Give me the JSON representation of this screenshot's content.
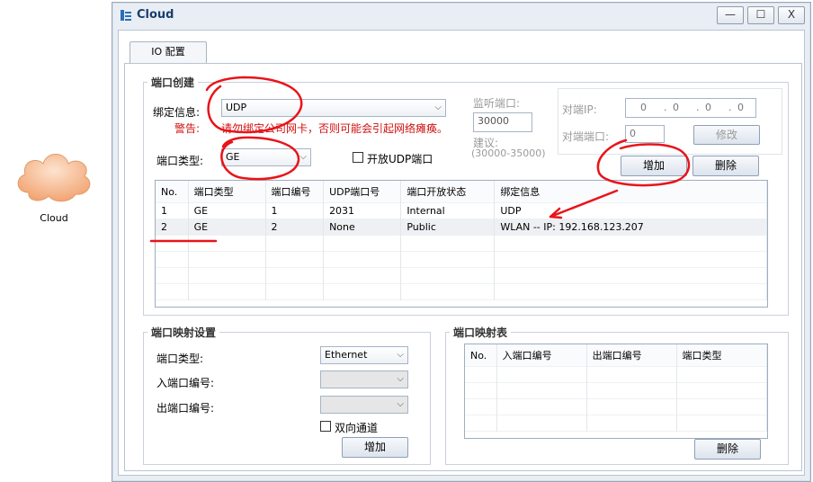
{
  "desktop": {
    "cloud_label": "Cloud"
  },
  "window": {
    "title": "Cloud",
    "controls": {
      "minimize": "—",
      "maximize": "☐",
      "close": "X"
    }
  },
  "tab": {
    "label": "IO 配置"
  },
  "port_create": {
    "title": "端口创建",
    "bind_label": "绑定信息:",
    "bind_value": "UDP",
    "warning_label": "警告:",
    "warning_text": "请勿绑定公司网卡，否则可能会引起网络瘫痪。",
    "listen_port_label": "监听端口:",
    "listen_port_value": "30000",
    "suggest_label": "建议:",
    "suggest_range": "(30000-35000)",
    "peer_ip_label": "对端IP:",
    "peer_ip_octets": [
      "0",
      "0",
      "0",
      "0"
    ],
    "peer_port_label": "对端端口:",
    "peer_port_value": "0",
    "modify_button": "修改",
    "port_type_label": "端口类型:",
    "port_type_value": "GE",
    "open_udp_label": "开放UDP端口",
    "add_button": "增加",
    "delete_button": "删除",
    "table": {
      "headers": [
        "No.",
        "端口类型",
        "端口编号",
        "UDP端口号",
        "端口开放状态",
        "绑定信息"
      ],
      "rows": [
        [
          "1",
          "GE",
          "1",
          "2031",
          "Internal",
          "UDP"
        ],
        [
          "2",
          "GE",
          "2",
          "None",
          "Public",
          "WLAN -- IP: 192.168.123.207"
        ]
      ]
    }
  },
  "port_map_settings": {
    "title": "端口映射设置",
    "port_type_label": "端口类型:",
    "port_type_value": "Ethernet",
    "in_port_label": "入端口编号:",
    "out_port_label": "出端口编号:",
    "bidirectional_label": "双向通道",
    "add_button": "增加"
  },
  "port_map_table": {
    "title": "端口映射表",
    "headers": [
      "No.",
      "入端口编号",
      "出端口编号",
      "端口类型"
    ],
    "delete_button": "删除"
  },
  "colors": {
    "annotation": "#e8141a",
    "accent": "#1a3d6d"
  }
}
